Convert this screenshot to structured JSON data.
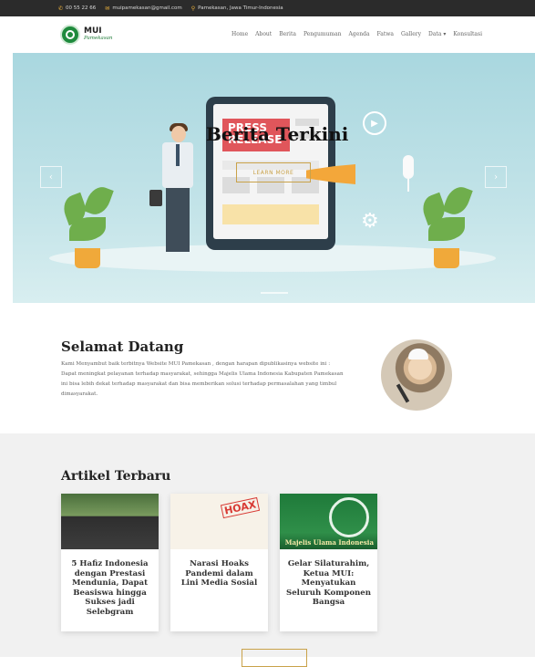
{
  "topbar": {
    "phone": "00 55 22 66",
    "email": "muipamekasan@gmail.com",
    "address": "Pamekasan, Jawa Timur-Indonesia"
  },
  "logo": {
    "title": "MUI",
    "subtitle": "Pamekasan"
  },
  "nav": {
    "items": [
      "Home",
      "About",
      "Berita",
      "Pengumuman",
      "Agenda",
      "Fatwa",
      "Gallery",
      "Data ▾",
      "Konsultasi"
    ]
  },
  "hero": {
    "title": "Berita Terkini",
    "button": "LEARN MORE",
    "press_text": "PRESS RELEASE",
    "prev": "‹",
    "next": "›"
  },
  "welcome": {
    "title": "Selamat Datang",
    "text": "Kami Menyambut baik terbitnya Website MUI Pamekasan , dengan harapan dipublikasinya website ini : Dapat meningkat pelayanan terhadap masyarakat, sehingga Majelis Ulama Indonesia Kabupaten Pamekasan ini bisa lebih dekat terhadap masyarakat dan bisa memberikan solusi terhadap permasalahan yang timbul dimasyarakat."
  },
  "articles": {
    "title": "Artikel Terbaru",
    "cards": [
      {
        "title": "5 Hafiz Indonesia dengan Prestasi Mendunia, Dapat Beasiswa hingga Sukses jadi Selebgram"
      },
      {
        "title": "Narasi Hoaks Pandemi dalam Lini Media Sosial",
        "badge": "HOAX"
      },
      {
        "title": "Gelar Silaturahim, Ketua MUI: Menyatukan Seluruh Komponen Bangsa",
        "image_caption": "Majelis Ulama Indonesia"
      }
    ]
  },
  "colors": {
    "accent": "#c9a24a",
    "brand_green": "#1e8a3c",
    "topbar": "#2b2b2b"
  }
}
